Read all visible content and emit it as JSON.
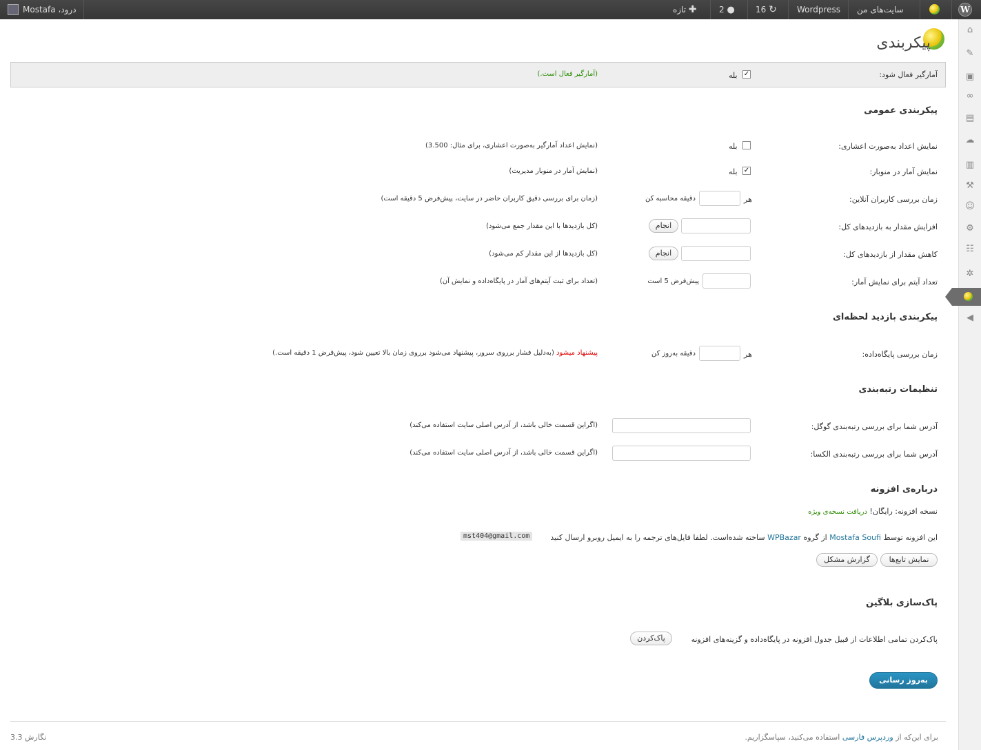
{
  "admin_bar": {
    "greeting": "درود، Mostafa",
    "new_label": "تازه",
    "comments_count": "2",
    "updates_count": "16",
    "wordpress_label": "Wordpress",
    "my_sites_label": "سایت‌های من"
  },
  "page": {
    "title": "پیکربندی"
  },
  "status": {
    "label": "آمارگیر فعال شود:",
    "checkbox_label": "بله",
    "message": "(آمارگیر فعال است.)"
  },
  "general": {
    "heading": "پیکربندی عمومی",
    "decimal_label": "نمایش اعداد به‌صورت اعشاری:",
    "decimal_check": "بله",
    "decimal_desc": "(نمایش اعداد آمارگیر به‌صورت اعشاری، برای مثال: 3.500)",
    "menubar_label": "نمایش آمار در منوبار:",
    "menubar_check": "بله",
    "menubar_desc": "(نمایش آمار در منوبار مدیریت)",
    "online_label": "زمان بررسی کاربران آنلاین:",
    "online_prefix": "هر",
    "online_suffix": "دقیقه محاسبه کن",
    "online_desc": "(زمان برای بررسی دقیق کاربران حاضر در سایت، پیش‌فرض 5 دقیقه است)",
    "increase_label": "افزایش مقدار به بازدیدهای کل:",
    "increase_button": "انجام",
    "increase_desc": "(کل بازدیدها با این مقدار جمع می‌شود)",
    "decrease_label": "کاهش مقدار از بازدیدهای کل:",
    "decrease_button": "انجام",
    "decrease_desc": "(کل بازدیدها از این مقدار کم می‌شود)",
    "items_label": "تعداد آیتم برای نمایش آمار:",
    "items_suffix": "پیش‌فرض 5 است",
    "items_desc": "(تعداد برای ثبت آیتم‌های آمار در پایگاه‌داده و نمایش آن)"
  },
  "realtime": {
    "heading": "پیکربندی بازدید لحظه‌ای",
    "db_label": "زمان بررسی پایگاه‌داده:",
    "db_prefix": "هر",
    "db_suffix": "دقیقه به‌روز کن",
    "db_desc_red": "پیشنهاد میشود",
    "db_desc": "(به‌دلیل فشار برروی سرور، پیشنهاد می‌شود برروی زمان بالا تعیین شود، پیش‌فرض 1 دقیقه است.)"
  },
  "rank": {
    "heading": "تنظیمات رتبه‌بندی",
    "google_label": "آدرس شما برای بررسی رتبه‌بندی گوگل:",
    "google_desc": "(اگراین قسمت خالی باشد، از آدرس اصلی سایت استفاده می‌کند)",
    "alexa_label": "آدرس شما برای بررسی رتبه‌بندی الکسا:",
    "alexa_desc": "(اگراین قسمت خالی باشد، از آدرس اصلی سایت استفاده می‌کند)"
  },
  "about": {
    "heading": "درباره‌ی افزونه",
    "version_text": "نسخه افزونه: رایگان!",
    "version_link": "دریافت نسخه‌ی ویژه",
    "credit_pre": "این افزونه توسط",
    "author_link": "Mostafa Soufi",
    "credit_mid": "از گروه",
    "group_link": "WPBazar",
    "credit_post": "ساخته شده‌است. لطفا فایل‌های ترجمه را به ایمیل روبرو ارسال کنید",
    "email": "mst404@gmail.com",
    "functions_button": "نمایش تابع‌ها",
    "report_button": "گزارش مشکل"
  },
  "cleanup": {
    "heading": "پاک‌سازی بلاگین",
    "text": "پاک‌کردن تمامی اطلاعات از قبیل جدول افزونه در پایگاه‌داده و گزینه‌های افزونه",
    "button": "پاک‌کردن"
  },
  "submit_label": "به‌روز رسانی",
  "footer": {
    "pre": "برای این‌که از",
    "link": "وردپرس فارسی",
    "post": "استفاده می‌کنید، سپاسگزاریم.",
    "version": "نگارش 3.3"
  },
  "colors": {
    "admin_bar": "#464646",
    "link": "#21759b",
    "status_green": "#2a8a00",
    "warning_red": "#dd0000",
    "primary_button": "#21759b"
  }
}
